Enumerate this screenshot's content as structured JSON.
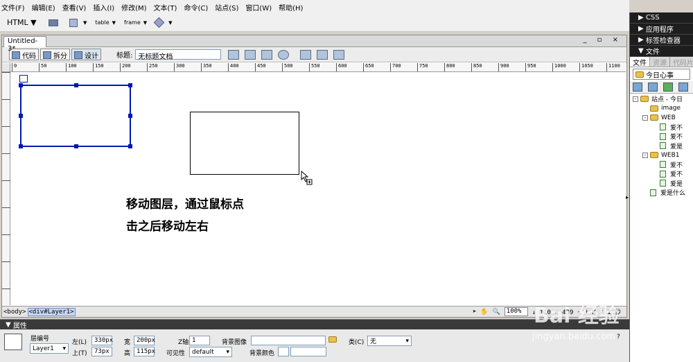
{
  "menu": [
    "文件(F)",
    "编辑(E)",
    "查看(V)",
    "插入(I)",
    "修改(M)",
    "文本(T)",
    "命令(C)",
    "站点(S)",
    "窗口(W)",
    "帮助(H)"
  ],
  "insert_bar": {
    "category": "HTML",
    "items": [
      "table",
      "frame"
    ]
  },
  "document": {
    "tab_title": "Untitled-3*",
    "window_controls": "_ ▫ ×",
    "view_code": "代码",
    "view_split": "拆分",
    "view_design": "设计",
    "title_label": "标题:",
    "title_value": "无标题文档"
  },
  "ruler": {
    "h_labels": [
      "0",
      "50",
      "100",
      "150",
      "200",
      "250",
      "300",
      "350",
      "400",
      "450",
      "500",
      "550",
      "600",
      "650",
      "700",
      "750",
      "800",
      "850",
      "900",
      "950",
      "1000",
      "1050",
      "1100"
    ]
  },
  "canvas_note": {
    "line1": "移动图层，通过鼠标点",
    "line2": "击之后移动左右"
  },
  "status": {
    "tag_body": "<body>",
    "tag_layer": "<div#Layer1>",
    "zoom": "100%",
    "size": "↓ 120 × 439 ▾ 1 K / 1 秒"
  },
  "properties": {
    "header": "属性",
    "layer_id_label": "层编号",
    "layer_id": "Layer1",
    "left_label": "左(L)",
    "left_value": "330px",
    "top_label": "上(T)",
    "top_value": "73px",
    "width_label": "宽",
    "width_value": "200px",
    "height_label": "高",
    "height_value": "115px",
    "z_label": "Z轴",
    "z_value": "1",
    "visibility_label": "可见性",
    "visibility_value": "default",
    "bg_image_label": "背景图像",
    "bg_color_label": "背景颜色",
    "class_label": "类(C)",
    "class_value": "无"
  },
  "side_panel": {
    "css": "CSS",
    "app": "应用程序",
    "tag_inspector": "标签检查器",
    "files": "文件",
    "tabs": [
      "文件",
      "资源",
      "代码片"
    ],
    "site": "今日心事",
    "tree": [
      {
        "label": "站点 - 今日",
        "type": "folder",
        "depth": 0,
        "exp": "-"
      },
      {
        "label": "image",
        "type": "folder",
        "depth": 1,
        "exp": ""
      },
      {
        "label": "WEB",
        "type": "folder",
        "depth": 1,
        "exp": "-"
      },
      {
        "label": "爱不",
        "type": "file",
        "depth": 2,
        "exp": ""
      },
      {
        "label": "爱不",
        "type": "file",
        "depth": 2,
        "exp": ""
      },
      {
        "label": "爱是",
        "type": "file",
        "depth": 2,
        "exp": ""
      },
      {
        "label": "WEB1",
        "type": "folder",
        "depth": 1,
        "exp": "-"
      },
      {
        "label": "爱不",
        "type": "file",
        "depth": 2,
        "exp": ""
      },
      {
        "label": "爱不",
        "type": "file",
        "depth": 2,
        "exp": ""
      },
      {
        "label": "爱是",
        "type": "file",
        "depth": 2,
        "exp": ""
      },
      {
        "label": "爱是什么",
        "type": "file",
        "depth": 1,
        "exp": ""
      }
    ]
  },
  "watermark": {
    "brand": "Bai 经验",
    "url": "jingyan.baidu.com"
  }
}
